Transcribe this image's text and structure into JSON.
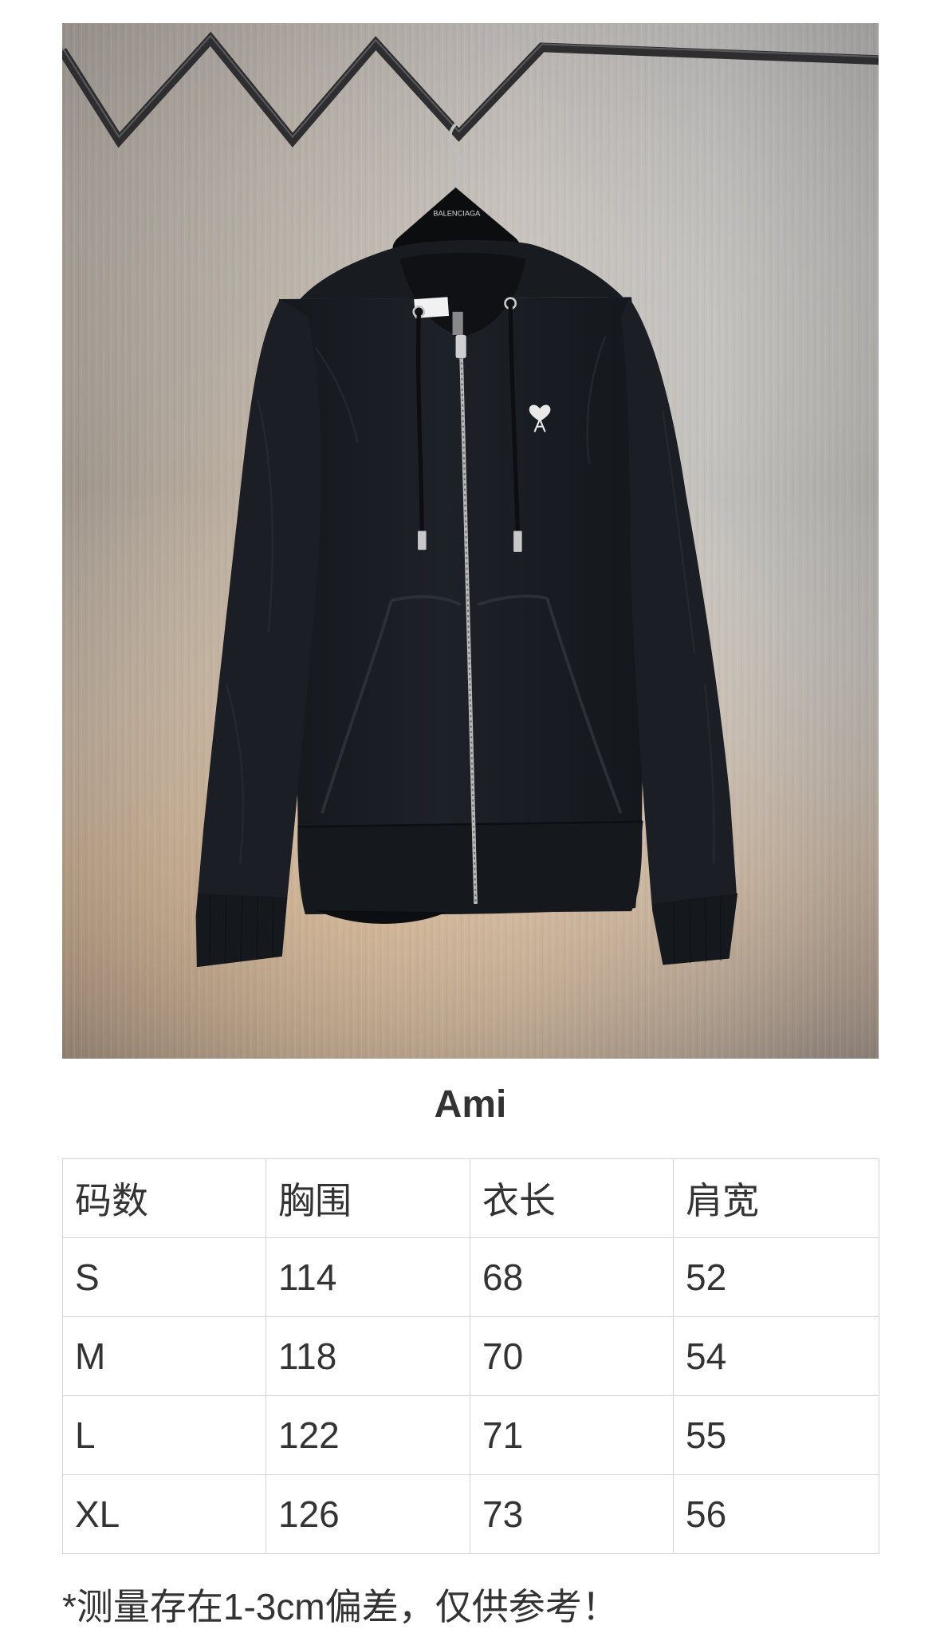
{
  "photo": {
    "hanger_brand": "BALENCIAGA"
  },
  "title": "Ami",
  "size_table": {
    "headers": [
      "码数",
      "胸围",
      "衣长",
      "肩宽"
    ],
    "rows": [
      [
        "S",
        "114",
        "68",
        "52"
      ],
      [
        "M",
        "118",
        "70",
        "54"
      ],
      [
        "L",
        "122",
        "71",
        "55"
      ],
      [
        "XL",
        "126",
        "73",
        "56"
      ]
    ]
  },
  "note": "*测量存在1-3cm偏差，仅供参考！",
  "colors": {
    "text": "#333333",
    "table_border": "#d4d4d4",
    "hoodie": "#181b21",
    "logo": "#e9e9e9"
  }
}
